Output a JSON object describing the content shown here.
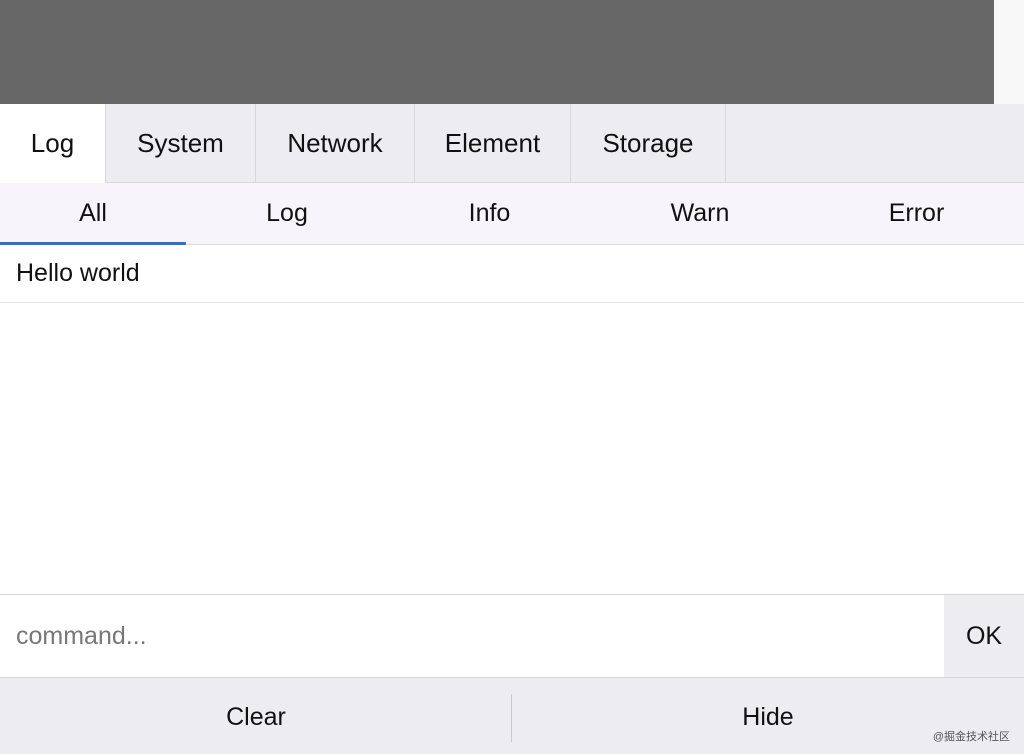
{
  "panel_tabs": [
    {
      "label": "Log",
      "active": true
    },
    {
      "label": "System",
      "active": false
    },
    {
      "label": "Network",
      "active": false
    },
    {
      "label": "Element",
      "active": false
    },
    {
      "label": "Storage",
      "active": false
    }
  ],
  "log_filters": [
    {
      "label": "All",
      "active": true
    },
    {
      "label": "Log",
      "active": false
    },
    {
      "label": "Info",
      "active": false
    },
    {
      "label": "Warn",
      "active": false
    },
    {
      "label": "Error",
      "active": false
    }
  ],
  "log_entries": [
    "Hello world"
  ],
  "command": {
    "value": "",
    "placeholder": "command...",
    "ok_label": "OK"
  },
  "footer": {
    "clear_label": "Clear",
    "hide_label": "Hide"
  },
  "watermark": "@掘金技术社区",
  "colors": {
    "mask": "#676767",
    "accent": "#2c6fd7",
    "tab_bar": "#ececf1"
  }
}
